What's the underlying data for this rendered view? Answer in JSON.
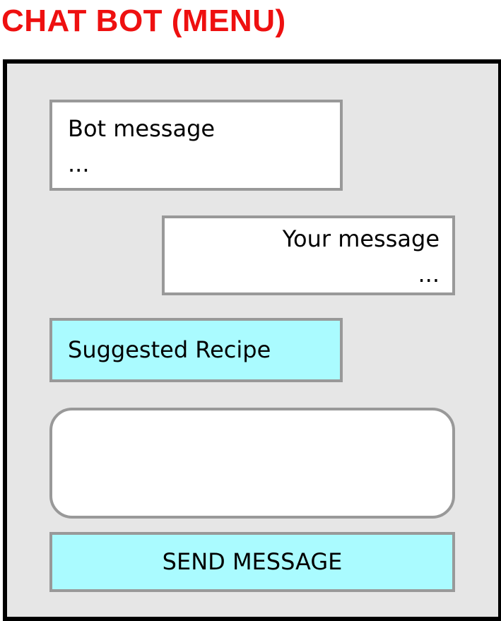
{
  "header": {
    "title": "CHAT BOT (MENU)"
  },
  "chat": {
    "bot_message": {
      "text": "Bot message",
      "continuation": "..."
    },
    "user_message": {
      "text": "Your message",
      "continuation": "..."
    },
    "suggested_recipe_label": "Suggested Recipe"
  },
  "composer": {
    "input_value": "",
    "send_label": "SEND MESSAGE"
  },
  "colors": {
    "title": "#ee1010",
    "frame_border": "#000000",
    "frame_background": "#e6e6e6",
    "box_border": "#999999",
    "accent_button": "#aafbff"
  }
}
